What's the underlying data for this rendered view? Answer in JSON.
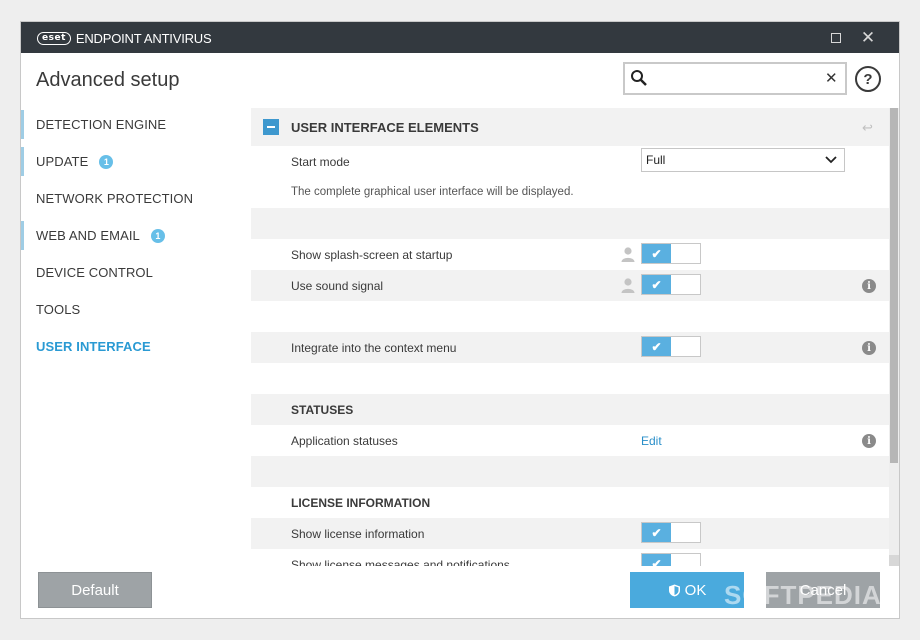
{
  "window": {
    "brand_logo": "eset",
    "brand_product": "ENDPOINT ANTIVIRUS",
    "maximize_icon": "maximize-icon",
    "close_icon": "close-icon",
    "close_glyph": "✕"
  },
  "header": {
    "title": "Advanced setup",
    "search": {
      "value": "",
      "placeholder": "",
      "clear_glyph": "✕"
    },
    "help_glyph": "?"
  },
  "sidebar": {
    "items": [
      {
        "label": "DETECTION ENGINE",
        "badge": ""
      },
      {
        "label": "UPDATE",
        "badge": "1"
      },
      {
        "label": "NETWORK PROTECTION",
        "badge": ""
      },
      {
        "label": "WEB AND EMAIL",
        "badge": "1"
      },
      {
        "label": "DEVICE CONTROL",
        "badge": ""
      },
      {
        "label": "TOOLS",
        "badge": ""
      },
      {
        "label": "USER INTERFACE",
        "badge": ""
      }
    ],
    "active_index": 6
  },
  "main": {
    "section_title": "USER INTERFACE ELEMENTS",
    "start_mode": {
      "label": "Start mode",
      "value": "Full",
      "description": "The complete graphical user interface will be displayed."
    },
    "settings": [
      {
        "label": "Show splash-screen at startup",
        "enabled": true
      },
      {
        "label": "Use sound signal",
        "enabled": true
      },
      {
        "label": "Integrate into the context menu",
        "enabled": true
      }
    ],
    "statuses": {
      "title": "STATUSES",
      "label": "Application statuses",
      "action": "Edit"
    },
    "license": {
      "title": "LICENSE INFORMATION",
      "items": [
        {
          "label": "Show license information",
          "enabled": true
        },
        {
          "label": "Show license messages and notifications",
          "enabled": true
        }
      ]
    },
    "check_glyph": "✔",
    "revert_glyph": "↩",
    "info_glyph": "i"
  },
  "footer": {
    "default_label": "Default",
    "ok_label": "OK",
    "cancel_label": "Cancel"
  },
  "watermark": "SOFTPEDIA",
  "colors": {
    "titlebar": "#33393f",
    "accent": "#2a9ad3",
    "toggle_on": "#5ab0e0",
    "ok_button": "#4aaadd",
    "secondary_button": "#9ea3a6"
  }
}
